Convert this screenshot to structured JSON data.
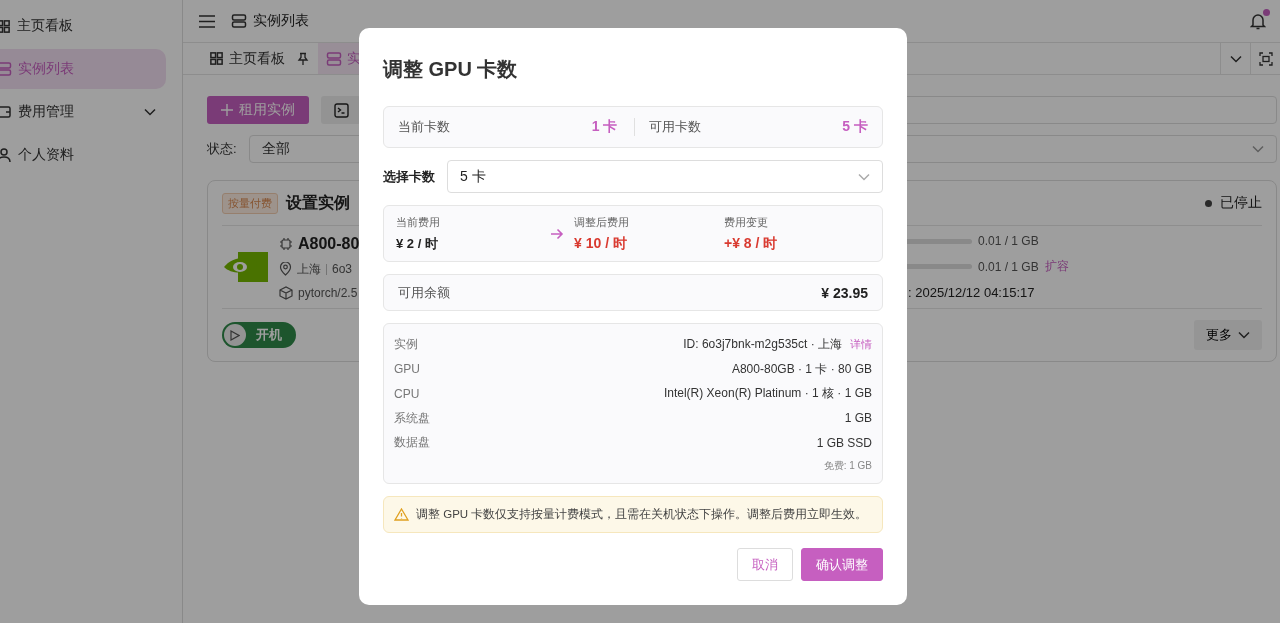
{
  "sidebar": {
    "items": [
      {
        "label": "主页看板",
        "selected": false,
        "kind": "link"
      },
      {
        "label": "实例列表",
        "selected": true,
        "kind": "link"
      },
      {
        "label": "费用管理",
        "selected": false,
        "kind": "group",
        "expanded": false
      },
      {
        "label": "个人资料",
        "selected": false,
        "kind": "link"
      }
    ]
  },
  "header": {
    "title": "实例列表",
    "notification_badge": true
  },
  "tabs": [
    {
      "label": "主页看板",
      "selected": false,
      "pinned": true
    },
    {
      "label": "实",
      "selected": true,
      "pinned": false
    }
  ],
  "toolbar": {
    "rent_button": "租用实例"
  },
  "filter": {
    "label": "状态:",
    "value": "全部"
  },
  "instance_card": {
    "billing_tag": "按量付费",
    "name": "设置实例",
    "status": "已停止",
    "gpu": "A800-80",
    "region": "上海",
    "id": "6o3",
    "image": "pytorch/2.5",
    "disks": [
      {
        "reading": "0.01 / 1 GB",
        "level": 0.01
      },
      {
        "reading": "0.01 / 1 GB",
        "level": 0.01,
        "action": "扩容"
      }
    ],
    "time": ": 2025/12/12 04:15:17",
    "start_button": "开机",
    "more_button": "更多"
  },
  "dialog": {
    "title": "调整 GPU 卡数",
    "cards": [
      {
        "label": "当前卡数",
        "value": "1 卡"
      },
      {
        "label": "可用卡数",
        "value": "5 卡"
      }
    ],
    "select": {
      "label": "选择卡数",
      "value": "5 卡"
    },
    "costs": [
      {
        "label": "当前费用",
        "value": "¥ 2 / 时",
        "kind": "current"
      },
      {
        "label": "调整后费用",
        "value": "¥ 10 / 时",
        "kind": "new"
      },
      {
        "label": "费用变更",
        "value": "+¥ 8 / 时",
        "kind": "change"
      }
    ],
    "balance": {
      "label": "可用余额",
      "value": "¥ 23.95"
    },
    "details": [
      {
        "label": "实例",
        "value": "ID: 6o3j7bnk-m2g535ct · 上海",
        "link": "详情"
      },
      {
        "label": "GPU",
        "value": "A800-80GB · 1 卡 · 80 GB"
      },
      {
        "label": "CPU",
        "value": "Intel(R) Xeon(R) Platinum · 1 核 · 1 GB"
      },
      {
        "label": "系统盘",
        "value": "1 GB"
      },
      {
        "label": "数据盘",
        "value": "1 GB SSD",
        "note": "免费: 1 GB"
      }
    ],
    "warning": "调整 GPU 卡数仅支持按量计费模式，且需在关机状态下操作。调整后费用立即生效。",
    "buttons": [
      {
        "label": "取消",
        "kind": "secondary"
      },
      {
        "label": "确认调整",
        "kind": "primary"
      }
    ]
  }
}
